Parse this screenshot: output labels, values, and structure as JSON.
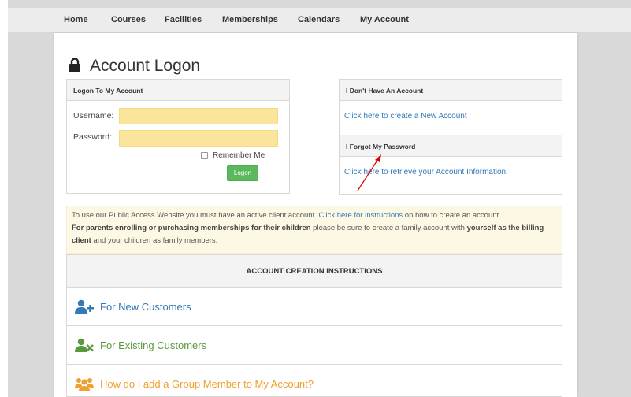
{
  "nav": {
    "items": [
      "Home",
      "Courses",
      "Facilities",
      "Memberships",
      "Calendars",
      "My Account"
    ]
  },
  "page": {
    "title": "Account Logon",
    "icon": "lock-icon"
  },
  "login": {
    "heading": "Logon To My Account",
    "username_label": "Username:",
    "password_label": "Password:",
    "remember_label": "Remember Me",
    "logon_label": "Logon"
  },
  "account": {
    "no_account_heading": "I Don't Have An Account",
    "create_link": "Click here to create a New Account",
    "forgot_heading": "I Forgot My Password",
    "retrieve_link": "Click here to retrieve your Account Information"
  },
  "notice": {
    "p1": "To use our Public Access Website you must have an active client account. ",
    "link": "Click here for instructions",
    "p2": " on how to create an account.",
    "bold1": "For parents enrolling or purchasing memberships for their children",
    "p3": " please be sure to create a family account with ",
    "bold2": "yourself as the billing client",
    "p4": " and your children as family members."
  },
  "instructions": {
    "heading": "ACCOUNT CREATION INSTRUCTIONS",
    "items": [
      {
        "label": "For New Customers",
        "color": "#337ab7",
        "icon": "user-plus-icon"
      },
      {
        "label": "For Existing Customers",
        "color": "#5a9a3c",
        "icon": "user-times-icon"
      },
      {
        "label": "How do I add a Group Member to My Account?",
        "color": "#f0a030",
        "icon": "users-icon"
      }
    ]
  },
  "colors": {
    "input_fill": "#fbe59c",
    "logon_button": "#5cb85c",
    "link": "#337ab7",
    "annotation_arrow": "#e00000"
  }
}
